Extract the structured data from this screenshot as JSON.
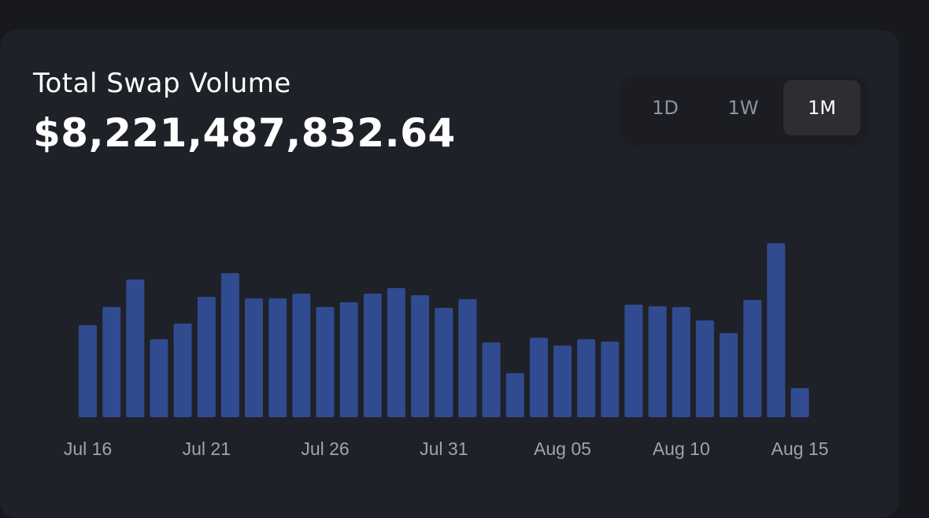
{
  "header": {
    "title": "Total Swap Volume",
    "amount": "$8,221,487,832.64"
  },
  "range_toggle": {
    "options": [
      "1D",
      "1W",
      "1M"
    ],
    "selected": "1M"
  },
  "colors": {
    "bar": "#304b8f",
    "background": "#1f2128",
    "active_toggle": "#2c2e34"
  },
  "chart_data": {
    "type": "bar",
    "title": "Total Swap Volume",
    "xlabel": "",
    "ylabel": "",
    "grid": false,
    "legend": "none",
    "ylim": [
      0,
      240
    ],
    "categories": [
      "Jul 16",
      "Jul 17",
      "Jul 18",
      "Jul 19",
      "Jul 20",
      "Jul 21",
      "Jul 22",
      "Jul 23",
      "Jul 24",
      "Jul 25",
      "Jul 26",
      "Jul 27",
      "Jul 28",
      "Jul 29",
      "Jul 30",
      "Jul 31",
      "Aug 01",
      "Aug 02",
      "Aug 03",
      "Aug 04",
      "Aug 05",
      "Aug 06",
      "Aug 07",
      "Aug 08",
      "Aug 09",
      "Aug 10",
      "Aug 11",
      "Aug 12",
      "Aug 13",
      "Aug 14",
      "Aug 15"
    ],
    "values": [
      117,
      140,
      175,
      99,
      119,
      153,
      183,
      151,
      151,
      157,
      140,
      146,
      157,
      164,
      155,
      139,
      150,
      95,
      56,
      101,
      91,
      99,
      96,
      143,
      141,
      140,
      123,
      107,
      149,
      221,
      37
    ],
    "tick_labels": [
      "Jul 16",
      "Jul 21",
      "Jul 26",
      "Jul 31",
      "Aug 05",
      "Aug 10",
      "Aug 15"
    ],
    "tick_indices": [
      0,
      5,
      10,
      15,
      20,
      25,
      30
    ]
  }
}
